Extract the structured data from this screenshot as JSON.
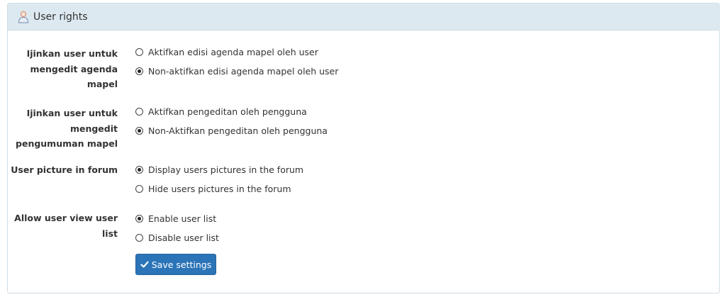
{
  "panel": {
    "title": "User rights",
    "icon": "user-icon"
  },
  "settings": [
    {
      "label": "Ijinkan user untuk mengedit agenda mapel",
      "label_lines": [
        "Ijinkan user untuk",
        "mengedit agenda",
        "mapel"
      ],
      "options": [
        {
          "text": "Aktifkan edisi agenda mapel oleh user",
          "checked": false
        },
        {
          "text": "Non-aktifkan edisi agenda mapel oleh user",
          "checked": true
        }
      ]
    },
    {
      "label": "Ijinkan user untuk mengedit pengumuman mapel",
      "label_lines": [
        "Ijinkan user untuk",
        "mengedit",
        "pengumuman mapel"
      ],
      "options": [
        {
          "text": "Aktifkan pengeditan oleh pengguna",
          "checked": false
        },
        {
          "text": "Non-Aktifkan pengeditan oleh pengguna",
          "checked": true
        }
      ]
    },
    {
      "label": "User picture in forum",
      "label_lines": [
        "User picture in forum"
      ],
      "options": [
        {
          "text": "Display users pictures in the forum",
          "checked": true
        },
        {
          "text": "Hide users pictures in the forum",
          "checked": false
        }
      ]
    },
    {
      "label": "Allow user view user list",
      "label_lines": [
        "Allow user view user",
        "list"
      ],
      "options": [
        {
          "text": "Enable user list",
          "checked": true
        },
        {
          "text": "Disable user list",
          "checked": false
        }
      ]
    }
  ],
  "save_button": {
    "label": "Save settings",
    "icon": "check-icon"
  },
  "colors": {
    "header_bg": "#dde9f0",
    "border": "#cfdde6",
    "button_bg": "#2b74b8"
  }
}
